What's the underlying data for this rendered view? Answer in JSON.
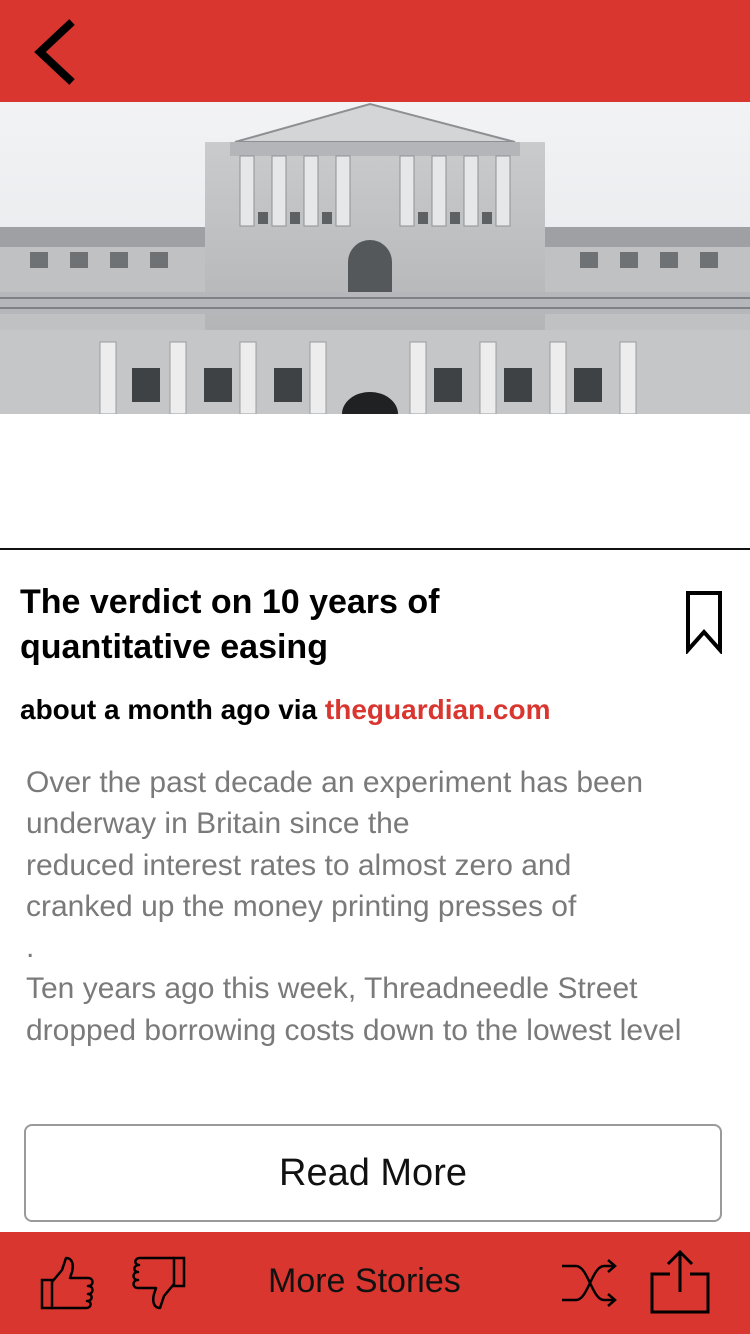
{
  "header": {
    "back_icon": "chevron-left-icon"
  },
  "article": {
    "title_line1": "The verdict on 10 years of",
    "title_line2": "quantitative easing",
    "meta_prefix": "about a month ago via ",
    "source": "theguardian.com",
    "body": [
      "Over the past decade an experiment has been",
      "underway in Britain since the",
      "reduced interest rates to almost zero and",
      "cranked up the money printing presses of",
      ".",
      "Ten years ago this week, Threadneedle Street",
      "dropped borrowing costs down to the lowest level"
    ],
    "bookmark_icon": "bookmark-icon"
  },
  "actions": {
    "read_more": "Read More"
  },
  "footer": {
    "more_stories": "More Stories",
    "icons": [
      "thumbs-up-icon",
      "thumbs-down-icon",
      "shuffle-icon",
      "share-icon"
    ]
  },
  "colors": {
    "brand_red": "#d93630",
    "body_gray": "#7a7a7a"
  }
}
